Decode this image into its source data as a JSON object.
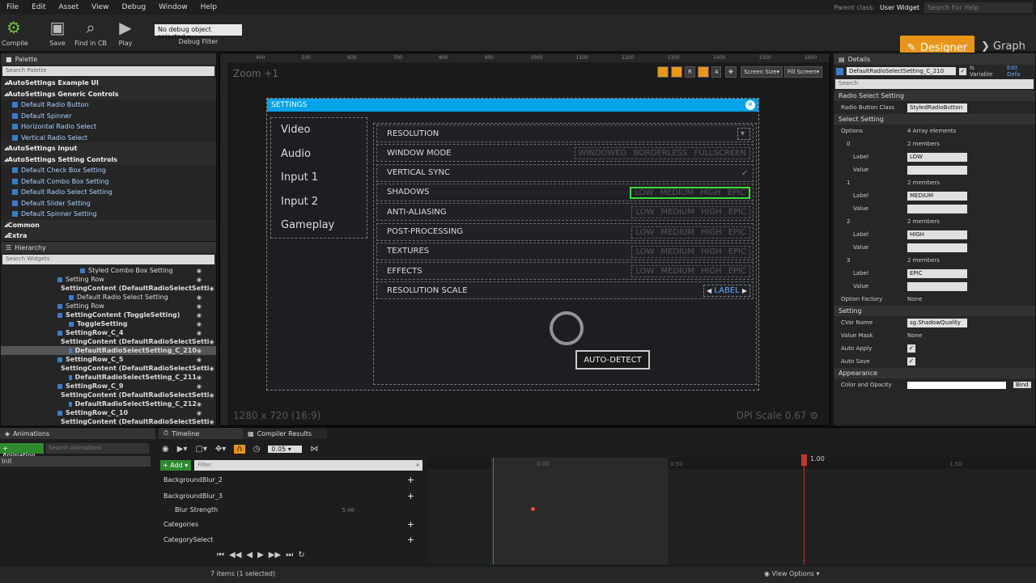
{
  "menu": {
    "items": [
      "File",
      "Edit",
      "Asset",
      "View",
      "Debug",
      "Window",
      "Help"
    ],
    "parent_class_label": "Parent class:",
    "parent_class_value": "User Widget",
    "search_help": "Search For Help"
  },
  "toolbar": {
    "compile": "Compile",
    "save": "Save",
    "find_in_cb": "Find in CB",
    "play": "Play",
    "debug_object": "No debug object selected",
    "debug_filter": "Debug Filter",
    "designer": "Designer",
    "graph": "Graph"
  },
  "palette": {
    "tab": "Palette",
    "search": "Search Palette",
    "sections": [
      {
        "label": "AutoSettings Example UI",
        "items": []
      },
      {
        "label": "AutoSettings Generic Controls",
        "items": [
          "Default Radio Button",
          "Default Spinner",
          "Horizontal Radio Select",
          "Vertical Radio Select"
        ]
      },
      {
        "label": "AutoSettings Input",
        "items": []
      },
      {
        "label": "AutoSettings Setting Controls",
        "items": [
          "Default Check Box Setting",
          "Default Combo Box Setting",
          "Default Radio Select Setting",
          "Default Slider Setting",
          "Default Spinner Setting"
        ]
      },
      {
        "label": "Common",
        "items": []
      },
      {
        "label": "Extra",
        "items": []
      }
    ]
  },
  "hierarchy": {
    "tab": "Hierarchy",
    "search": "Search Widgets",
    "rows": [
      {
        "label": "Styled Combo Box Setting",
        "indent": 98,
        "bold": false
      },
      {
        "label": "Setting Row",
        "indent": 70,
        "bold": false
      },
      {
        "label": "SettingContent (DefaultRadioSelectSetti",
        "indent": 70,
        "bold": true
      },
      {
        "label": "Default Radio Select Setting",
        "indent": 84,
        "bold": false
      },
      {
        "label": "Setting Row",
        "indent": 70,
        "bold": false
      },
      {
        "label": "SettingContent (ToggleSetting)",
        "indent": 70,
        "bold": true
      },
      {
        "label": "ToggleSetting",
        "indent": 84,
        "bold": true
      },
      {
        "label": "SettingRow_C_4",
        "indent": 70,
        "bold": true
      },
      {
        "label": "SettingContent (DefaultRadioSelectSetti",
        "indent": 70,
        "bold": true
      },
      {
        "label": "DefaultRadioSelectSetting_C_210",
        "indent": 84,
        "bold": true,
        "selected": true
      },
      {
        "label": "SettingRow_C_5",
        "indent": 70,
        "bold": true
      },
      {
        "label": "SettingContent (DefaultRadioSelectSetti",
        "indent": 70,
        "bold": true
      },
      {
        "label": "DefaultRadioSelectSetting_C_211",
        "indent": 84,
        "bold": true
      },
      {
        "label": "SettingRow_C_9",
        "indent": 70,
        "bold": true
      },
      {
        "label": "SettingContent (DefaultRadioSelectSetti",
        "indent": 70,
        "bold": true
      },
      {
        "label": "DefaultRadioSelectSetting_C_212",
        "indent": 84,
        "bold": true
      },
      {
        "label": "SettingRow_C_10",
        "indent": 70,
        "bold": true
      },
      {
        "label": "SettingContent (DefaultRadioSelectSetti",
        "indent": 70,
        "bold": true
      }
    ]
  },
  "canvas": {
    "zoom": "Zoom +1",
    "resolution": "1280 x 720 (16:9)",
    "dpi": "DPI Scale 0.67",
    "screen_size": "Screen Size",
    "fill_screen": "Fill Screen",
    "r_label": "R",
    "ruler": [
      "400",
      "500",
      "600",
      "700",
      "800",
      "900",
      "1000",
      "1100",
      "1200",
      "1300",
      "1400",
      "1500",
      "1600"
    ],
    "ui": {
      "title": "SETTINGS",
      "categories": [
        "Video",
        "Audio",
        "Input 1",
        "Input 2",
        "Gameplay"
      ],
      "settings": [
        {
          "label": "RESOLUTION",
          "type": "combo",
          "options": []
        },
        {
          "label": "WINDOW MODE",
          "type": "options",
          "options": [
            "WINDOWED",
            "BORDERLESS",
            "FULLSCREEN"
          ]
        },
        {
          "label": "VERTICAL SYNC",
          "type": "toggle",
          "options": []
        },
        {
          "label": "SHADOWS",
          "type": "options",
          "options": [
            "LOW",
            "MEDIUM",
            "HIGH",
            "EPIC"
          ],
          "highlight": true
        },
        {
          "label": "ANTI-ALIASING",
          "type": "options",
          "options": [
            "LOW",
            "MEDIUM",
            "HIGH",
            "EPIC"
          ]
        },
        {
          "label": "POST-PROCESSING",
          "type": "options",
          "options": [
            "LOW",
            "MEDIUM",
            "HIGH",
            "EPIC"
          ]
        },
        {
          "label": "TEXTURES",
          "type": "options",
          "options": [
            "LOW",
            "MEDIUM",
            "HIGH",
            "EPIC"
          ]
        },
        {
          "label": "EFFECTS",
          "type": "options",
          "options": [
            "LOW",
            "MEDIUM",
            "HIGH",
            "EPIC"
          ]
        },
        {
          "label": "RESOLUTION SCALE",
          "type": "spinner",
          "options": [
            "LABEL"
          ]
        }
      ],
      "auto_detect": "AUTO-DETECT"
    }
  },
  "details": {
    "tab": "Details",
    "name": "DefaultRadioSelectSetting_C_210",
    "is_variable": "Is Variable",
    "edit_defaults": "Edit Defa",
    "search": "Search",
    "radio_section": "Radio Select Setting",
    "radio_button_class_label": "Radio Button Class",
    "radio_button_class_value": "StyledRadioButton",
    "select_section": "Select Setting",
    "options_label": "Options",
    "options_value": "4 Array elements",
    "elements": [
      {
        "index": "0",
        "members": "2 members",
        "label": "LOW"
      },
      {
        "index": "1",
        "members": "2 members",
        "label": "MEDIUM"
      },
      {
        "index": "2",
        "members": "2 members",
        "label": "HIGH"
      },
      {
        "index": "3",
        "members": "2 members",
        "label": "EPIC"
      }
    ],
    "label_key": "Label",
    "value_key": "Value",
    "option_factory_label": "Option Factory",
    "option_factory_value": "None",
    "setting_section": "Setting",
    "cvar_label": "CVar Name",
    "cvar_value": "sg.ShadowQuality",
    "value_mask_label": "Value Mask",
    "value_mask_value": "None",
    "auto_apply": "Auto Apply",
    "auto_save": "Auto Save",
    "appearance_section": "Appearance",
    "color_label": "Color and Opacity",
    "bind": "Bind"
  },
  "animations": {
    "tab": "Animations",
    "add_button": "+ Animation",
    "search": "Search Animations",
    "item": "Init"
  },
  "timeline": {
    "tab": "Timeline",
    "compiler_tab": "Compiler Results",
    "add": "+ Add",
    "filter": "Filter",
    "snap": "0.05",
    "tracks": [
      {
        "label": "BackgroundBlur_2"
      },
      {
        "label": "BackgroundBlur_3"
      },
      {
        "label": "Blur Strength",
        "value": "5.46"
      },
      {
        "label": "Categories"
      },
      {
        "label": "CategorySelect"
      }
    ],
    "marks": [
      "0.00",
      "0.50",
      "1.00",
      "1.50"
    ],
    "end_mark": "1.00",
    "items_status": "7 items (1 selected)",
    "view_options": "View Options"
  }
}
